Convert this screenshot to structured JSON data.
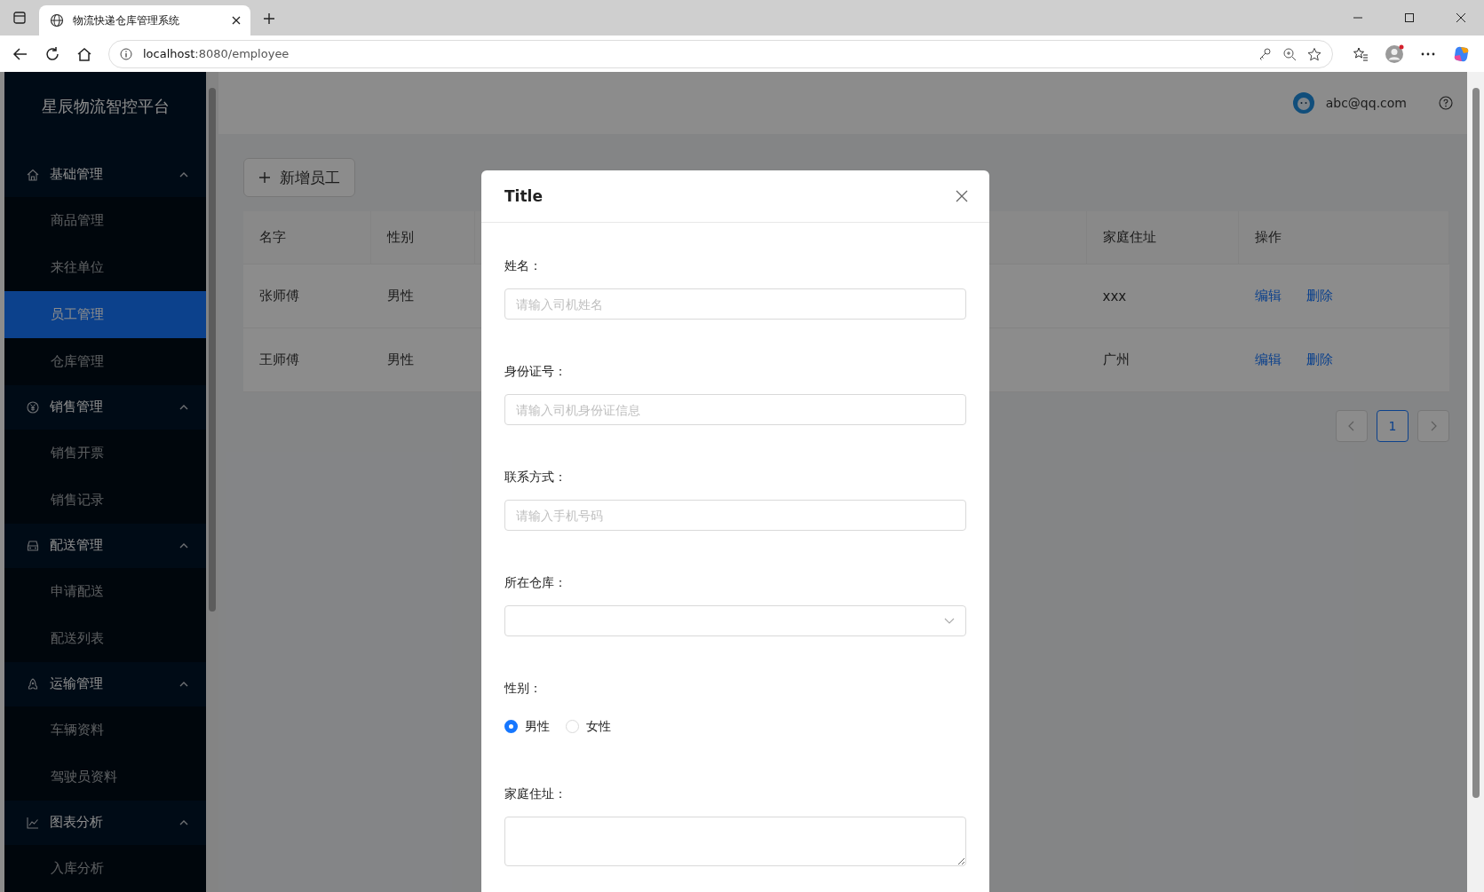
{
  "browser": {
    "tab_title": "物流快递仓库管理系统",
    "url_host": "localhost",
    "url_rest": ":8080/employee"
  },
  "sidebar": {
    "title": "星辰物流智控平台",
    "groups": [
      {
        "label": "基础管理",
        "expanded": true,
        "children": [
          {
            "label": "商品管理",
            "selected": false
          },
          {
            "label": "来往单位",
            "selected": false
          },
          {
            "label": "员工管理",
            "selected": true
          },
          {
            "label": "仓库管理",
            "selected": false
          }
        ]
      },
      {
        "label": "销售管理",
        "expanded": true,
        "children": [
          {
            "label": "销售开票",
            "selected": false
          },
          {
            "label": "销售记录",
            "selected": false
          }
        ]
      },
      {
        "label": "配送管理",
        "expanded": true,
        "children": [
          {
            "label": "申请配送",
            "selected": false
          },
          {
            "label": "配送列表",
            "selected": false
          }
        ]
      },
      {
        "label": "运输管理",
        "expanded": true,
        "children": [
          {
            "label": "车辆资料",
            "selected": false
          },
          {
            "label": "驾驶员资料",
            "selected": false
          }
        ]
      },
      {
        "label": "图表分析",
        "expanded": true,
        "children": [
          {
            "label": "入库分析",
            "selected": false
          }
        ]
      }
    ]
  },
  "header": {
    "user": "abc@qq.com"
  },
  "add_button": "新增员工",
  "table": {
    "columns": [
      "名字",
      "性别",
      "家庭住址",
      "操作"
    ],
    "rows": [
      {
        "name": "张师傅",
        "gender": "男性",
        "address": "xxx",
        "actions": [
          "编辑",
          "删除"
        ]
      },
      {
        "name": "王师傅",
        "gender": "男性",
        "address": "广州",
        "actions": [
          "编辑",
          "删除"
        ]
      }
    ]
  },
  "pagination": {
    "pages": [
      {
        "label": "1",
        "selected": true
      }
    ]
  },
  "modal": {
    "title": "Title",
    "fields": [
      {
        "kind": "input",
        "label": "姓名：",
        "placeholder": "请输入司机姓名"
      },
      {
        "kind": "input",
        "label": "身份证号：",
        "placeholder": "请输入司机身份证信息"
      },
      {
        "kind": "input",
        "label": "联系方式：",
        "placeholder": "请输入手机号码"
      },
      {
        "kind": "select",
        "label": "所在仓库："
      },
      {
        "kind": "radio",
        "label": "性别：",
        "options": [
          {
            "label": "男性",
            "selected": true
          },
          {
            "label": "女性",
            "selected": false
          }
        ]
      },
      {
        "kind": "textarea",
        "label": "家庭住址："
      }
    ]
  }
}
